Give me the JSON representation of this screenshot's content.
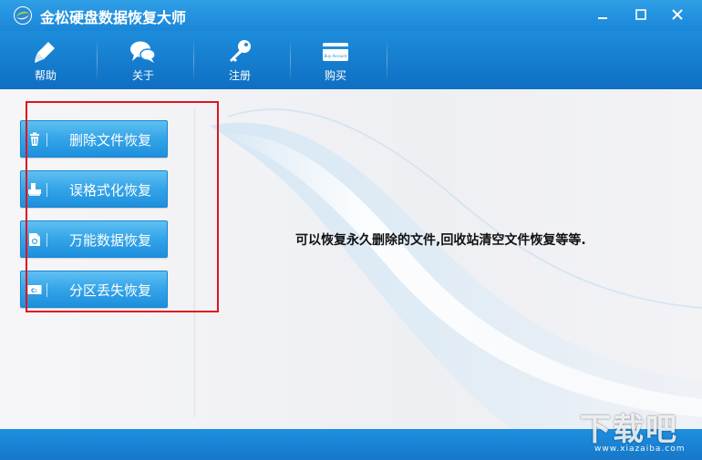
{
  "window": {
    "title": "金松硬盘数据恢复大师"
  },
  "toolbar": {
    "items": [
      {
        "label": "帮助",
        "icon": "pen-icon"
      },
      {
        "label": "关于",
        "icon": "chat-bubbles-icon"
      },
      {
        "label": "注册",
        "icon": "key-icon"
      },
      {
        "label": "购买",
        "icon": "card-icon",
        "card_text": "Buy Account"
      }
    ]
  },
  "modes": [
    {
      "label": "删除文件恢复",
      "icon": "trash-icon"
    },
    {
      "label": "误格式化恢复",
      "icon": "format-icon"
    },
    {
      "label": "万能数据恢复",
      "icon": "document-icon"
    },
    {
      "label": "分区丢失恢复",
      "icon": "partition-icon",
      "icon_text": "C:"
    }
  ],
  "description": "可以恢复永久删除的文件,回收站清空文件恢复等等.",
  "watermark": {
    "text": "下载吧",
    "url": "www.xiazaiba.com"
  },
  "colors": {
    "titlebar": "#1a86d8",
    "toolbar": "#1d8ddb",
    "mode_button": "#34a4e8",
    "highlight": "#e0141e"
  }
}
